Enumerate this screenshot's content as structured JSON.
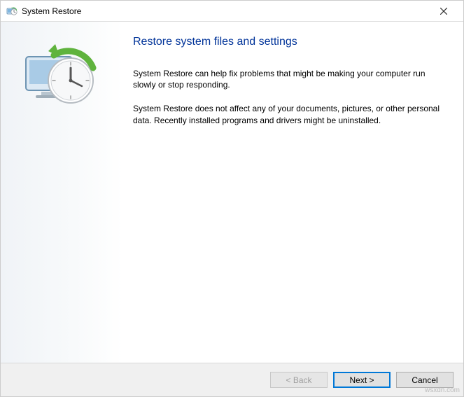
{
  "window": {
    "title": "System Restore",
    "icon_name": "system-restore-icon"
  },
  "heading": "Restore system files and settings",
  "paragraphs": {
    "p1": "System Restore can help fix problems that might be making your computer run slowly or stop responding.",
    "p2": "System Restore does not affect any of your documents, pictures, or other personal data. Recently installed programs and drivers might be uninstalled."
  },
  "buttons": {
    "back": "< Back",
    "next": "Next >",
    "cancel": "Cancel"
  },
  "watermark": "wsxdn.com"
}
